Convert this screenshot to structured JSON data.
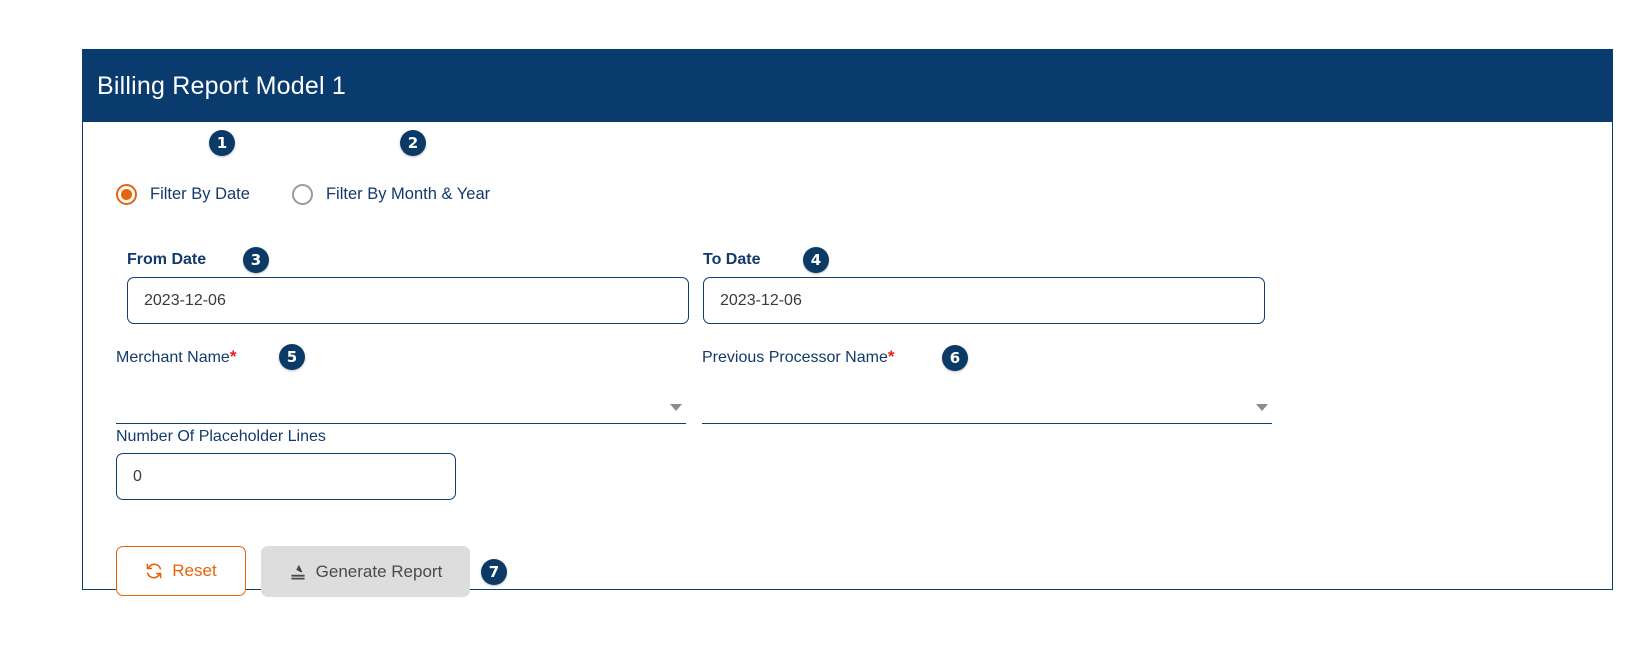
{
  "card": {
    "title": "Billing Report Model 1"
  },
  "colors": {
    "header_bg": "#0a3b6e",
    "card_border": "#0b3b70",
    "badge_bg": "#0c3a67",
    "accent_orange": "#e8630a",
    "label_navy": "#123a6b",
    "required_red": "#ef1a1a",
    "disabled_button_bg": "#dddddd"
  },
  "filter_mode": {
    "options": [
      {
        "label": "Filter By Date",
        "selected": true,
        "badge": "1"
      },
      {
        "label": "Filter By Month & Year",
        "selected": false,
        "badge": "2"
      }
    ]
  },
  "fields": {
    "from_date": {
      "label": "From Date",
      "value": "2023-12-06",
      "badge": "3"
    },
    "to_date": {
      "label": "To Date",
      "value": "2023-12-06",
      "badge": "4"
    },
    "merchant_name": {
      "label": "Merchant Name",
      "required_marker": "*",
      "value": "",
      "badge": "5"
    },
    "previous_processor_name": {
      "label": "Previous Processor Name",
      "required_marker": "*",
      "value": "",
      "badge": "6"
    },
    "placeholder_lines": {
      "label": "Number Of Placeholder Lines",
      "value": "0"
    }
  },
  "actions": {
    "reset": {
      "label": "Reset",
      "icon": "refresh-icon"
    },
    "generate": {
      "label": "Generate Report",
      "icon": "export-report-icon",
      "badge": "7",
      "disabled": true
    }
  }
}
